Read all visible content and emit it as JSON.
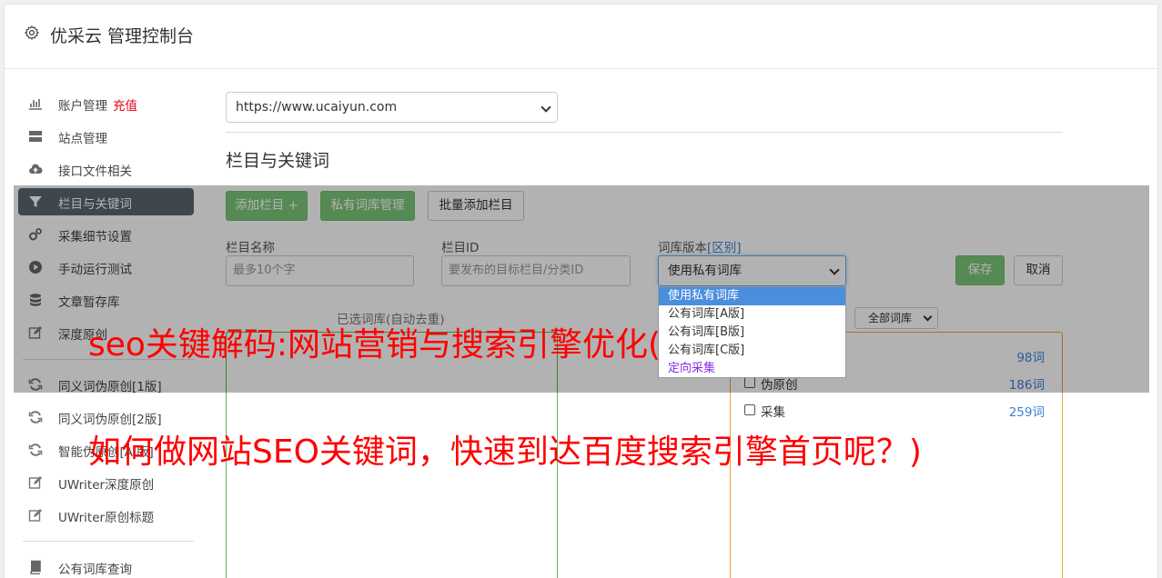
{
  "header": {
    "title": "优采云 管理控制台",
    "icon": "gear-icon"
  },
  "sidebar": {
    "items": [
      {
        "label": "账户管理",
        "badge": "充值",
        "icon": "bar-chart-icon"
      },
      {
        "label": "站点管理",
        "icon": "server-icon"
      },
      {
        "label": "接口文件相关",
        "icon": "cloud-upload-icon"
      },
      {
        "label": "栏目与关键词",
        "icon": "filter-icon",
        "active": true
      },
      {
        "label": "采集细节设置",
        "icon": "gears-icon"
      },
      {
        "label": "手动运行测试",
        "icon": "play-circle-icon"
      },
      {
        "label": "文章暂存库",
        "icon": "database-icon"
      },
      {
        "label": "深度原创",
        "icon": "edit-icon"
      },
      {
        "label": "同义词伪原创[1版]",
        "icon": "refresh-icon"
      },
      {
        "label": "同义词伪原创[2版]",
        "icon": "refresh-icon"
      },
      {
        "label": "智能伪原创[AI版]",
        "icon": "refresh-icon"
      },
      {
        "label": "UWriter深度原创",
        "icon": "edit-icon"
      },
      {
        "label": "UWriter原创标题",
        "icon": "edit-icon"
      },
      {
        "label": "公有词库查询",
        "icon": "book-icon"
      }
    ]
  },
  "main": {
    "site_value": "https://www.ucaiyun.com",
    "section_title": "栏目与关键词",
    "buttons": {
      "add_column": "添加栏目 +",
      "private_lib": "私有词库管理",
      "batch_add": "批量添加栏目",
      "save": "保存",
      "cancel": "取消"
    },
    "fields": {
      "column_name_label": "栏目名称",
      "column_name_placeholder": "最多10个字",
      "column_id_label": "栏目ID",
      "column_id_placeholder": "要发布的目标栏目/分类ID",
      "lib_version_label": "词库版本",
      "lib_version_link": "[区别]",
      "lib_version_value": "使用私有词库"
    },
    "dropdown_options": [
      "使用私有词库",
      "公有词库[A版]",
      "公有词库[B版]",
      "公有词库[C版]",
      "定向采集"
    ],
    "selected_panel_label": "已选词库(自动去重)",
    "lib_filter_value": "全部词库",
    "categories": [
      {
        "name": "",
        "count": "98词"
      },
      {
        "name": "伪原创",
        "count": "186词"
      },
      {
        "name": "采集",
        "count": "259词"
      }
    ]
  },
  "watermark": {
    "line1": "seo关键解码:网站营销与搜索引擎优化(",
    "line2": "如何做网站SEO关键词，快速到达百度搜索引擎首页呢？)"
  },
  "colors": {
    "accent_green": "#7cc67a",
    "active_nav": "#5a6670",
    "watermark": "#ff0000",
    "link_blue": "#3d7fd6"
  }
}
